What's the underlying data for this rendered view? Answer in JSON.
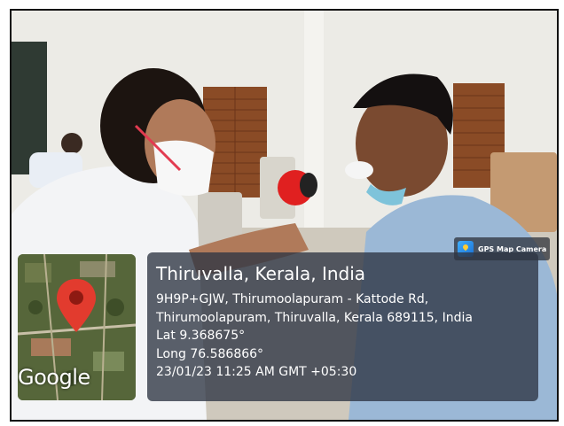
{
  "badge": {
    "label": "GPS Map Camera",
    "icon": "map-camera-app-icon"
  },
  "map": {
    "provider_logo": "Google",
    "pin_icon": "location-pin-icon",
    "pin_color": "#e23b2e"
  },
  "location": {
    "title": "Thiruvalla, Kerala, India",
    "address_line_1": "9H9P+GJW, Thirumoolapuram - Kattode Rd,",
    "address_line_2": "Thirumoolapuram, Thiruvalla, Kerala 689115, India",
    "latitude": "Lat 9.368675°",
    "longitude": "Long 76.586866°",
    "timestamp": "23/01/23 11:25 AM GMT +05:30"
  },
  "colors": {
    "overlay": "#2d3442",
    "text": "#ffffff"
  }
}
